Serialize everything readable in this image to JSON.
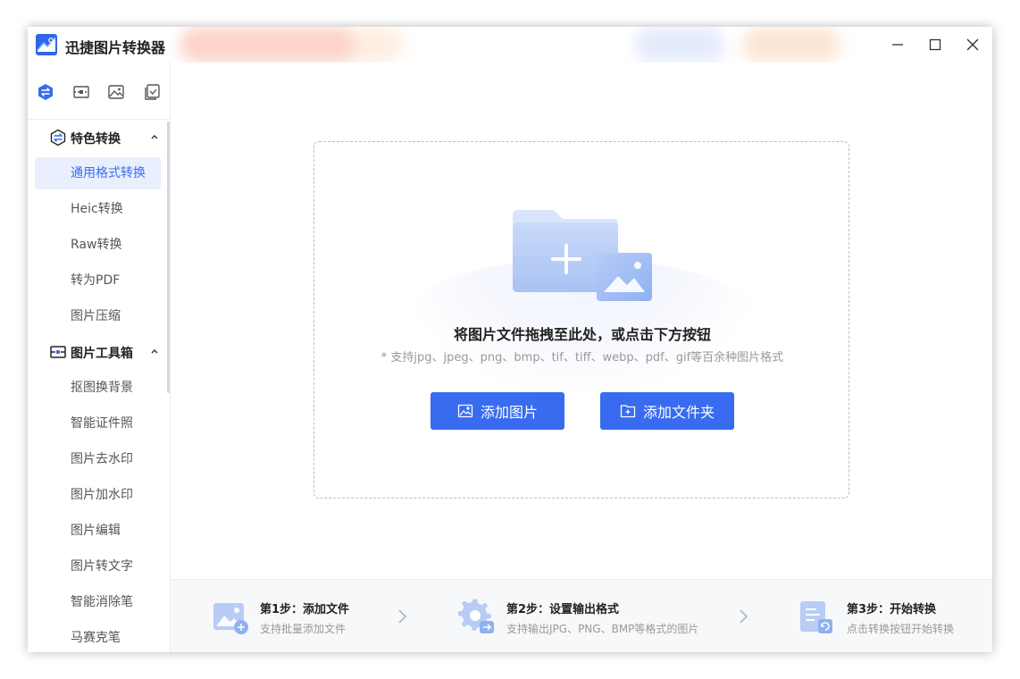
{
  "app": {
    "title": "迅捷图片转换器",
    "accent_color": "#386bef"
  },
  "window_controls": {
    "minimize_icon": "minimize-icon",
    "maximize_icon": "maximize-icon",
    "close_icon": "close-icon"
  },
  "side_tabs": [
    {
      "icon": "convert-tab-icon",
      "active": true
    },
    {
      "icon": "toolbox-tab-icon",
      "active": false
    },
    {
      "icon": "image-tab-icon",
      "active": false
    },
    {
      "icon": "tasks-tab-icon",
      "active": false
    }
  ],
  "sidebar": {
    "groups": [
      {
        "label": "特色转换",
        "icon": "convert-icon",
        "expanded": true,
        "items": [
          "通用格式转换",
          "Heic转换",
          "Raw转换",
          "转为PDF",
          "图片压缩"
        ]
      },
      {
        "label": "图片工具箱",
        "icon": "toolbox-icon",
        "expanded": true,
        "items": [
          "抠图换背景",
          "智能证件照",
          "图片去水印",
          "图片加水印",
          "图片编辑",
          "图片转文字",
          "智能消除笔",
          "马赛克笔"
        ]
      }
    ],
    "active_item": "通用格式转换"
  },
  "dropzone": {
    "title": "将图片文件拖拽至此处，或点击下方按钮",
    "hint": "* 支持jpg、jpeg、png、bmp、tif、tiff、webp、pdf、gif等百余种图片格式",
    "add_image_label": "添加图片",
    "add_folder_label": "添加文件夹"
  },
  "steps": [
    {
      "title": "第1步：添加文件",
      "desc": "支持批量添加文件",
      "icon": "add-file-step-icon"
    },
    {
      "title": "第2步：设置输出格式",
      "desc": "支持输出JPG、PNG、BMP等格式的图片",
      "icon": "settings-step-icon"
    },
    {
      "title": "第3步：开始转换",
      "desc": "点击转换按钮开始转换",
      "icon": "convert-step-icon"
    }
  ]
}
